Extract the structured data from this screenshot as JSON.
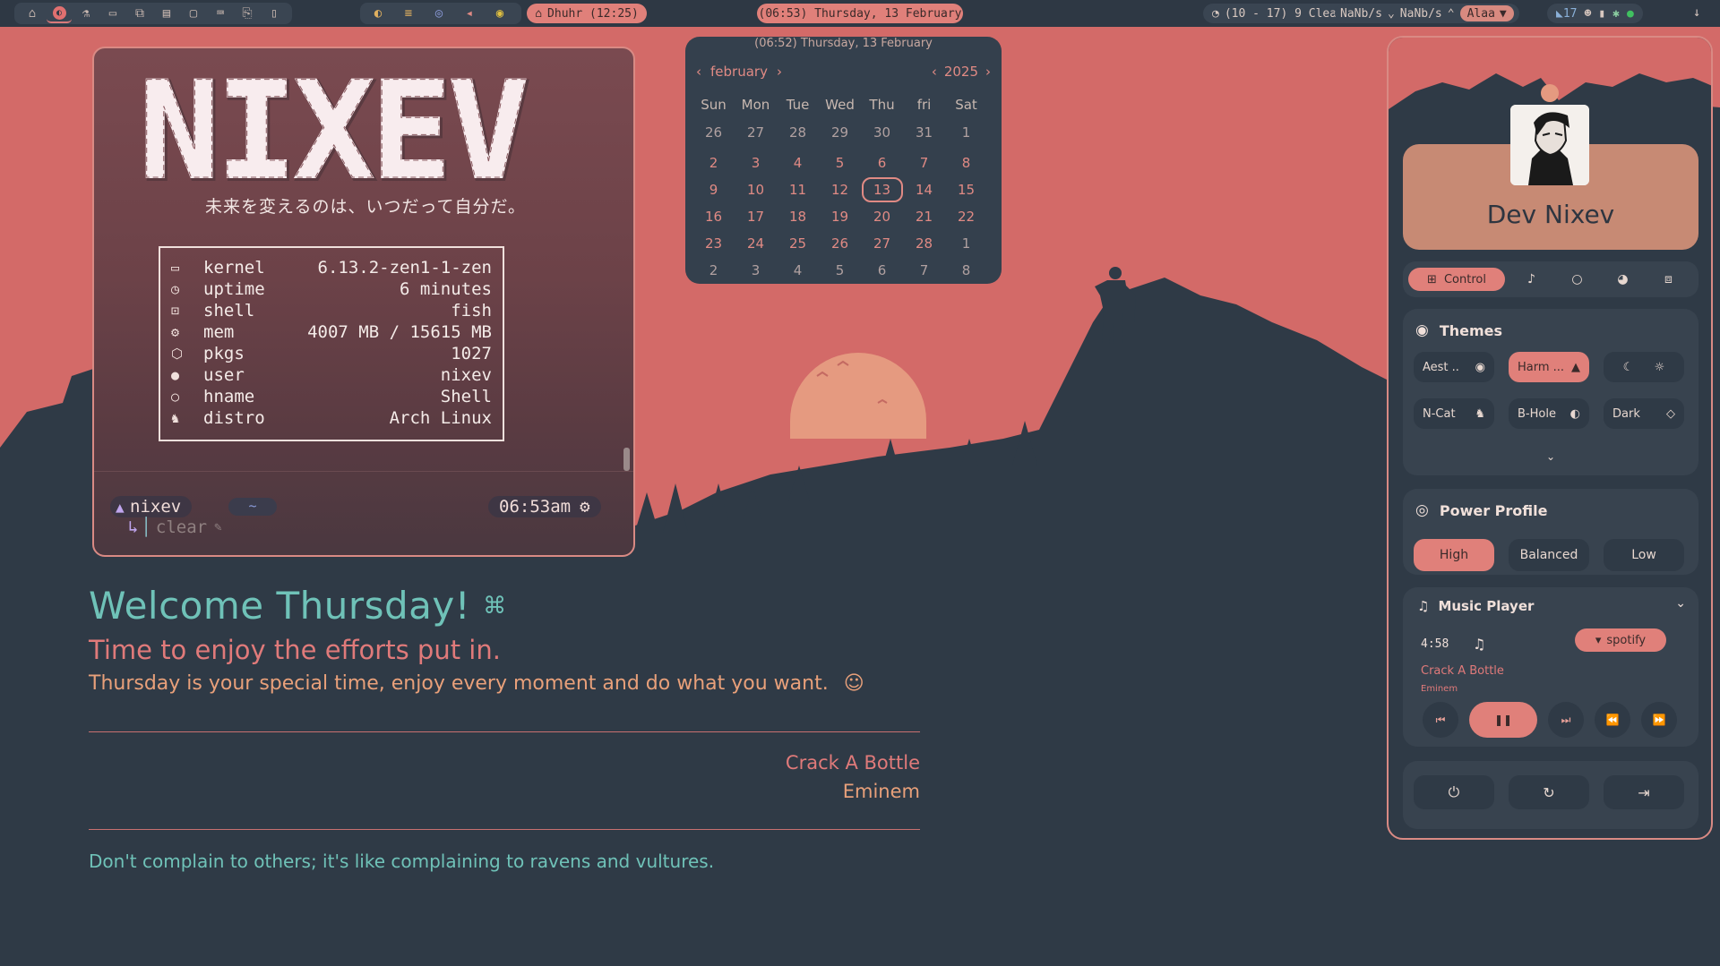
{
  "topbar": {
    "workspace_icons": [
      "home-icon",
      "arch-icon",
      "flask-icon",
      "folder-icon",
      "files-icon",
      "chat-icon",
      "folder-open-icon",
      "keyboard-icon",
      "document-icon",
      "flashlight-icon"
    ],
    "prayer": "Dhuhr (12:25)",
    "clock": "(06:53) Thursday, 13 February",
    "weather": "(10 - 17) 9 Clear",
    "net_down": "NaNb/s",
    "net_up": "NaNb/s",
    "wifi": "Alaa",
    "notifications": "17"
  },
  "terminal": {
    "logo": "NIXEV",
    "motto": "未来を変えるのは、いつだって自分だ。",
    "fetch": [
      {
        "icon": "laptop-icon",
        "glyph": "▭",
        "key": "kernel",
        "value": "6.13.2-zen1-1-zen"
      },
      {
        "icon": "clock-icon",
        "glyph": "◷",
        "key": "uptime",
        "value": "6 minutes"
      },
      {
        "icon": "shell-icon",
        "glyph": "⊡",
        "key": "shell",
        "value": "fish"
      },
      {
        "icon": "memory-icon",
        "glyph": "⚙",
        "key": "mem",
        "value": "4007 MB / 15615 MB"
      },
      {
        "icon": "package-icon",
        "glyph": "⬡",
        "key": "pkgs",
        "value": "1027"
      },
      {
        "icon": "user-icon",
        "glyph": "●",
        "key": "user",
        "value": "nixev"
      },
      {
        "icon": "circle-icon",
        "glyph": "○",
        "key": "hname",
        "value": "Shell"
      },
      {
        "icon": "linux-icon",
        "glyph": "♞",
        "key": "distro",
        "value": "Arch Linux"
      }
    ],
    "prompt_user": "nixev",
    "prompt_dir": "~",
    "prompt_time": "06:53am",
    "command": "clear"
  },
  "calendar": {
    "header": "(06:52) Thursday, 13 February",
    "month": "february",
    "year": "2025",
    "weekdays": [
      "Sun",
      "Mon",
      "Tue",
      "Wed",
      "Thu",
      "fri",
      "Sat"
    ],
    "prev_row": [
      "26",
      "27",
      "28",
      "29",
      "30",
      "31",
      "1"
    ],
    "weeks": [
      [
        "2",
        "3",
        "4",
        "5",
        "6",
        "7",
        "8"
      ],
      [
        "9",
        "10",
        "11",
        "12",
        "13",
        "14",
        "15"
      ],
      [
        "16",
        "17",
        "18",
        "19",
        "20",
        "21",
        "22"
      ],
      [
        "23",
        "24",
        "25",
        "26",
        "27",
        "28",
        "1"
      ],
      [
        "2",
        "3",
        "4",
        "5",
        "6",
        "7",
        "8"
      ]
    ],
    "today": "13"
  },
  "welcome": {
    "title": "Welcome Thursday!",
    "subtitle": "Time to enjoy the efforts put in.",
    "body": "Thursday is your special time, enjoy every moment and do what you want.",
    "song_title": "Crack A Bottle",
    "song_artist": "Eminem",
    "quote": "Don't complain to others; it's like complaining to ravens and vultures."
  },
  "panel": {
    "name": "Dev Nixev",
    "tabs": {
      "control": "Control"
    },
    "themes": {
      "title": "Themes",
      "row1": [
        "Aest ..",
        "Harm ..."
      ],
      "row2": [
        "N-Cat",
        "B-Hole",
        "Dark"
      ]
    },
    "power": {
      "title": "Power Profile",
      "options": [
        "High",
        "Balanced",
        "Low"
      ],
      "selected": "High"
    },
    "music": {
      "title": "Music Player",
      "time": "4:58",
      "source": "spotify",
      "song": "Crack A Bottle",
      "artist": "Eminem"
    }
  },
  "colors": {
    "accent": "#e0807a",
    "background": "#2f3a46",
    "sky": "#d46a68",
    "teal": "#6fc2b8"
  }
}
